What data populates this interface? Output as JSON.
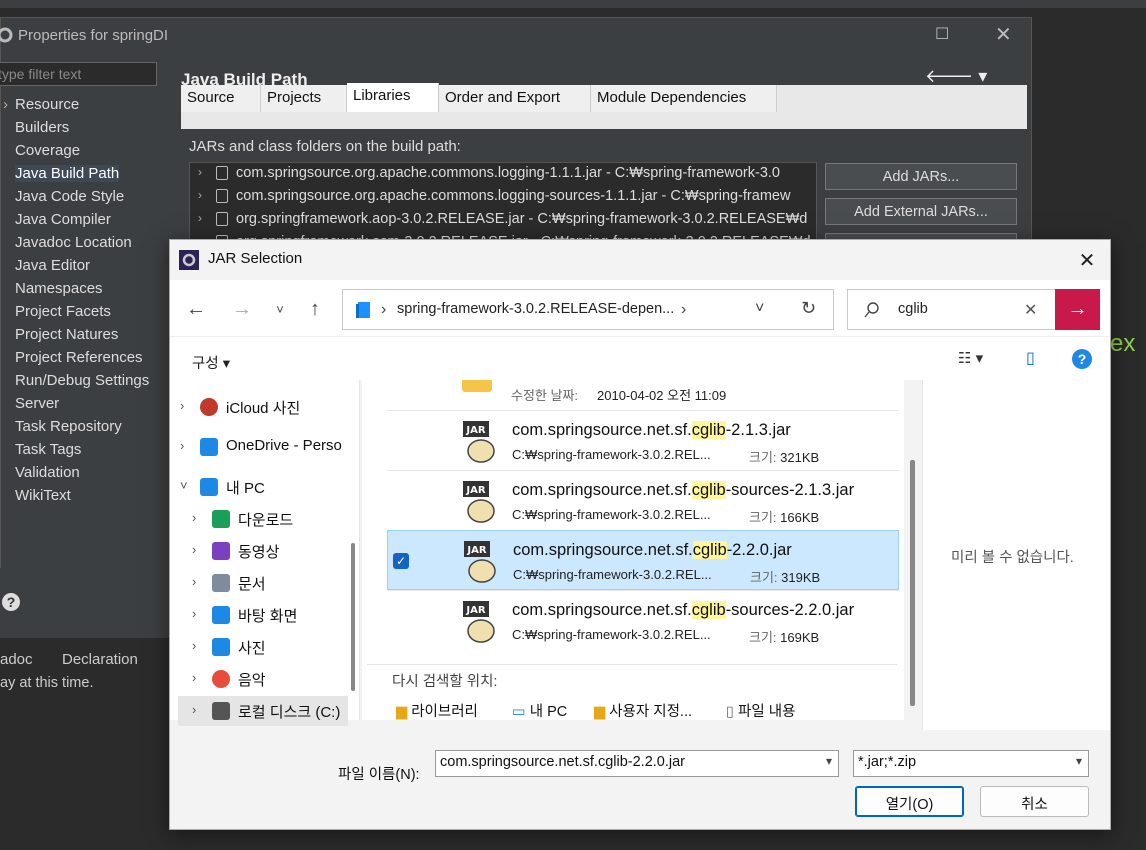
{
  "background": {
    "properties_title": "Properties for springDI",
    "filter_placeholder": "type filter text",
    "page_title": "Java Build Path",
    "tree_items": [
      "Resource",
      "Builders",
      "Coverage",
      "Java Build Path",
      "Java Code Style",
      "Java Compiler",
      "Javadoc Location",
      "Java Editor",
      "Namespaces",
      "Project Facets",
      "Project Natures",
      "Project References",
      "Run/Debug Settings",
      "Server",
      "Task Repository",
      "Task Tags",
      "Validation",
      "WikiText"
    ],
    "tabs": [
      "Source",
      "Projects",
      "Libraries",
      "Order and Export",
      "Module Dependencies"
    ],
    "libraries_label": "JARs and class folders on the build path:",
    "jars": [
      "com.springsource.org.apache.commons.logging-1.1.1.jar - C:₩spring-framework-3.0",
      "com.springsource.org.apache.commons.logging-sources-1.1.1.jar - C:₩spring-framew",
      "org.springframework.aop-3.0.2.RELEASE.jar - C:₩spring-framework-3.0.2.RELEASE₩d",
      "org.springframework.asm-3.0.2.RELEASE.jar - C:₩spring-framework-3.0.2.RELEASE₩d"
    ],
    "add_jars": "Add JARs...",
    "add_external_jars": "Add External JARs...",
    "view_tab_javadoc": "adoc",
    "view_tab_declaration": "Declaration",
    "status_message": "ay at this time.",
    "context_text": "ex"
  },
  "dialog": {
    "title": "JAR Selection",
    "address": "spring-framework-3.0.2.RELEASE-depen...",
    "search_value": "cglib",
    "organize": "구성",
    "nav_items": [
      "iCloud 사진",
      "OneDrive - Perso",
      "내 PC",
      "다운로드",
      "동영상",
      "문서",
      "바탕 화면",
      "사진",
      "음악",
      "로컬 디스크 (C:)"
    ],
    "partial_row": {
      "modified_label": "수정한 날짜:",
      "modified_value": "2010-04-02 오전 11:09"
    },
    "files": [
      {
        "pre": "com.springsource.net.sf.",
        "hl": "cglib",
        "post": "-2.1.3.jar",
        "path": "C:₩spring-framework-3.0.2.REL...",
        "size_label": "크기:",
        "size": "321KB"
      },
      {
        "pre": "com.springsource.net.sf.",
        "hl": "cglib",
        "post": "-sources-2.1.3.jar",
        "path": "C:₩spring-framework-3.0.2.REL...",
        "size_label": "크기:",
        "size": "166KB"
      },
      {
        "pre": "com.springsource.net.sf.",
        "hl": "cglib",
        "post": "-2.2.0.jar",
        "path": "C:₩spring-framework-3.0.2.REL...",
        "size_label": "크기:",
        "size": "319KB"
      },
      {
        "pre": "com.springsource.net.sf.",
        "hl": "cglib",
        "post": "-sources-2.2.0.jar",
        "path": "C:₩spring-framework-3.0.2.REL...",
        "size_label": "크기:",
        "size": "169KB"
      }
    ],
    "research_label": "다시 검색할 위치:",
    "research_items": [
      "라이브러리",
      "내 PC",
      "사용자 지정...",
      "파일 내용"
    ],
    "preview_text": "미리 볼 수 없습니다.",
    "filename_label": "파일 이름(N):",
    "filename_value": "com.springsource.net.sf.cglib-2.2.0.jar",
    "filetype_value": "*.jar;*.zip",
    "open_button": "열기(O)",
    "cancel_button": "취소"
  }
}
